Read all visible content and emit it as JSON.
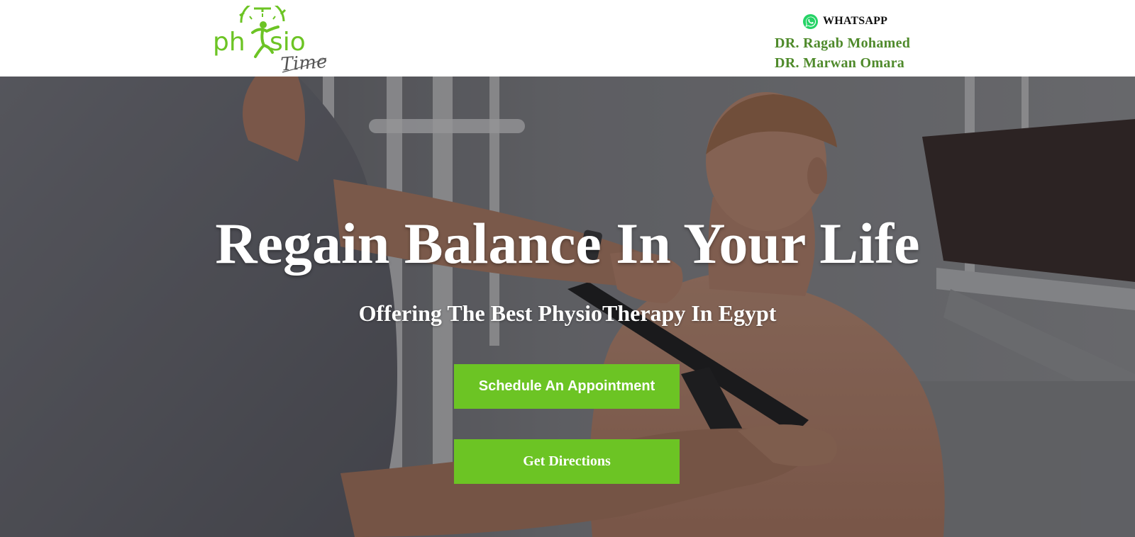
{
  "header": {
    "logo": {
      "text_main": "phsio",
      "text_script": "Time",
      "icon": "stopwatch-figure-logo"
    },
    "contact": {
      "whatsapp_label": "WHATSAPP",
      "whatsapp_icon": "whatsapp-icon",
      "doctors": [
        "DR. Ragab Mohamed",
        "DR. Marwan Omara"
      ]
    }
  },
  "hero": {
    "title": "Regain Balance In Your Life",
    "subtitle": "Offering The Best PhysioTherapy In Egypt",
    "buttons": {
      "schedule_label": "Schedule An Appointment",
      "directions_label": "Get Directions"
    },
    "background_image": "physiotherapist-taping-patient-shoulder"
  },
  "colors": {
    "brand_green": "#6cc424",
    "doctor_text_green": "#4f8a2b",
    "whatsapp_green": "#25d366"
  }
}
